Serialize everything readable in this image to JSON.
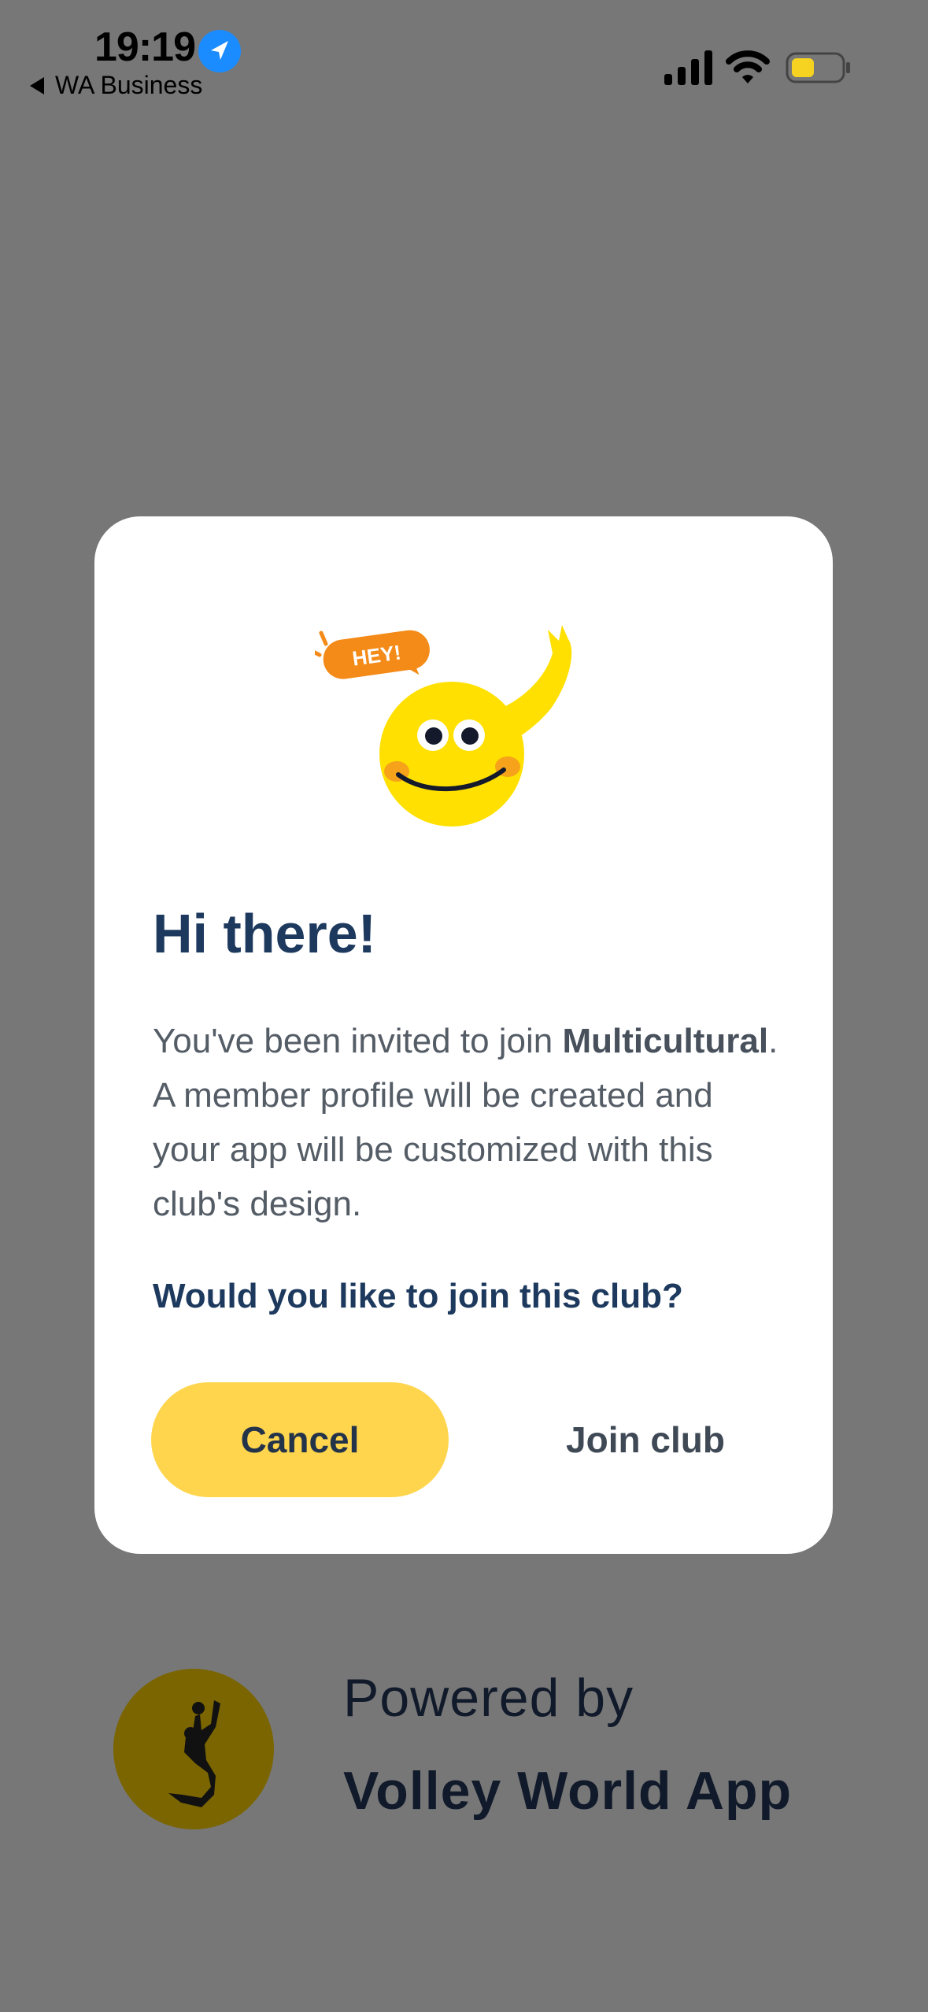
{
  "status_bar": {
    "time": "19:19",
    "back_app": "WA Business"
  },
  "dialog": {
    "badge_text": "HEY!",
    "title": "Hi there!",
    "body_prefix": "You've been invited to join ",
    "club_name": "Multicultural",
    "body_suffix": ". A member profile will be created and your app will be customized with this club's design.",
    "question": "Would you like to join this club?",
    "cancel_label": "Cancel",
    "join_label": "Join club"
  },
  "footer": {
    "powered_label": "Powered by",
    "app_name": "Volley World App"
  },
  "colors": {
    "backdrop": "#777777",
    "accent_yellow": "#fed54d",
    "title_navy": "#1d3a5e",
    "badge_orange": "#f48a17"
  }
}
